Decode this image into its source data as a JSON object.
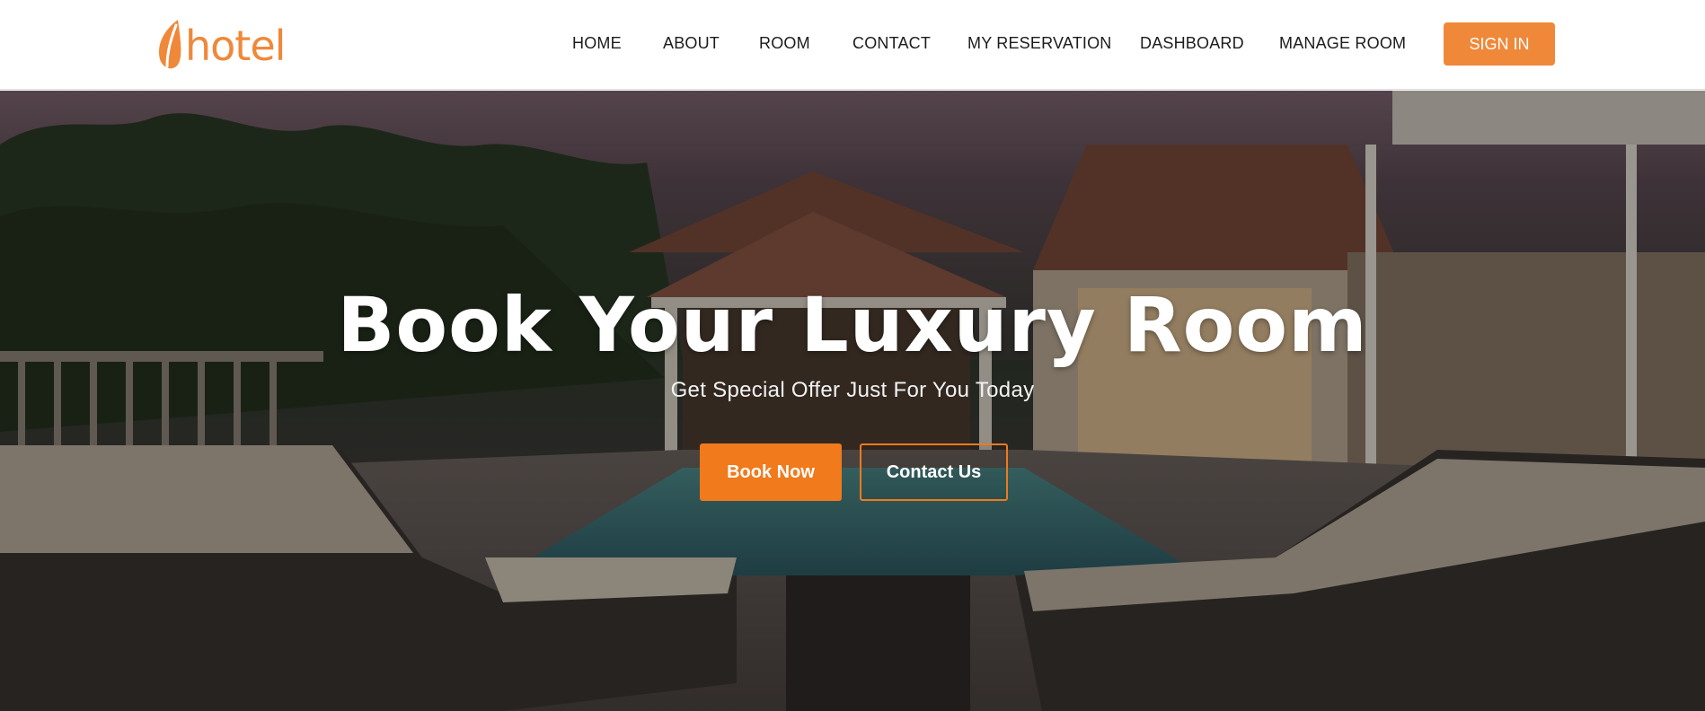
{
  "brand": {
    "name": "hotel",
    "accent": "#f0883a"
  },
  "nav": {
    "items": [
      {
        "label": "HOME"
      },
      {
        "label": "ABOUT"
      },
      {
        "label": "ROOM"
      },
      {
        "label": "CONTACT"
      },
      {
        "label": "MY RESERVATION"
      },
      {
        "label": "DASHBOARD"
      },
      {
        "label": "MANAGE ROOM"
      }
    ],
    "signin_label": "SIGN IN"
  },
  "hero": {
    "title": "Book Your Luxury Room",
    "subtitle": "Get Special Offer Just For You Today",
    "primary_button": "Book Now",
    "secondary_button": "Contact Us",
    "background_image": "luxury villa with pool and sun loungers at dusk"
  },
  "colors": {
    "primary": "#f07a1c",
    "nav_text": "#1c1c1c",
    "header_bg": "#ffffff"
  },
  "icons": {
    "logo": "leaf-icon"
  }
}
